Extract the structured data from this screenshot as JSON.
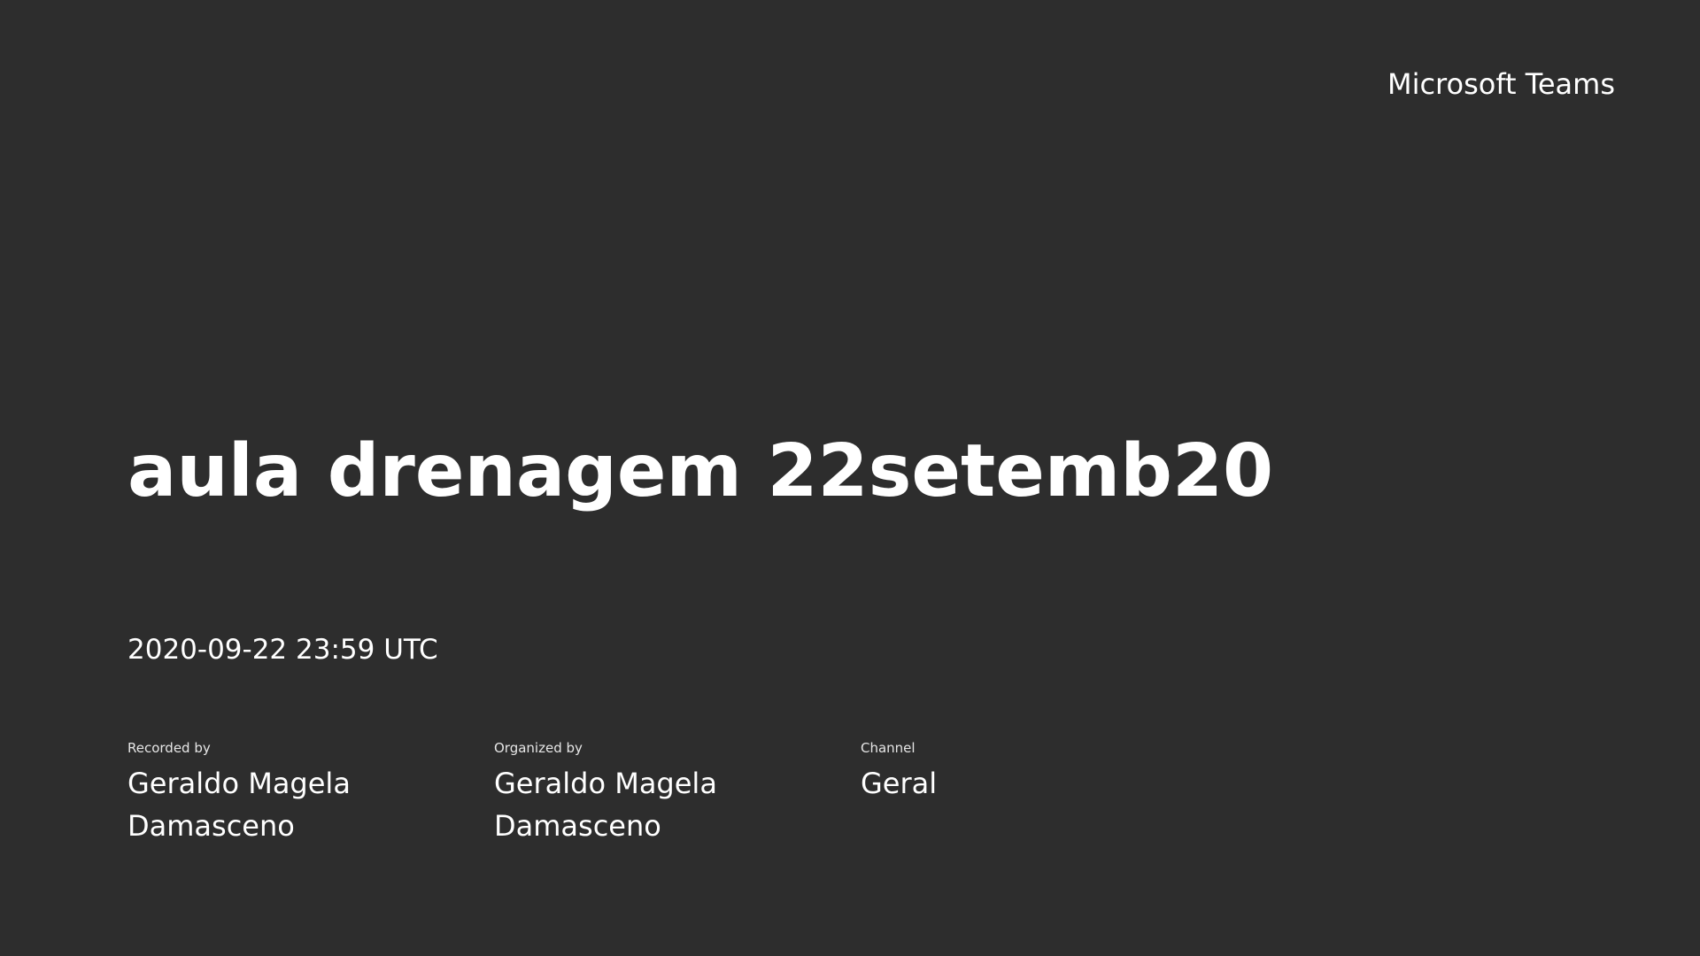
{
  "app_name": "Microsoft Teams",
  "title": "aula drenagem 22setemb20",
  "timestamp": "2020-09-22 23:59 UTC",
  "details": {
    "recorded": {
      "label": "Recorded by",
      "value": "Geraldo Magela Damasceno"
    },
    "organized": {
      "label": "Organized by",
      "value": "Geraldo Magela Damasceno"
    },
    "channel": {
      "label": "Channel",
      "value": "Geral"
    }
  },
  "colors": {
    "background": "#2d2d2d",
    "text": "#ffffff"
  }
}
